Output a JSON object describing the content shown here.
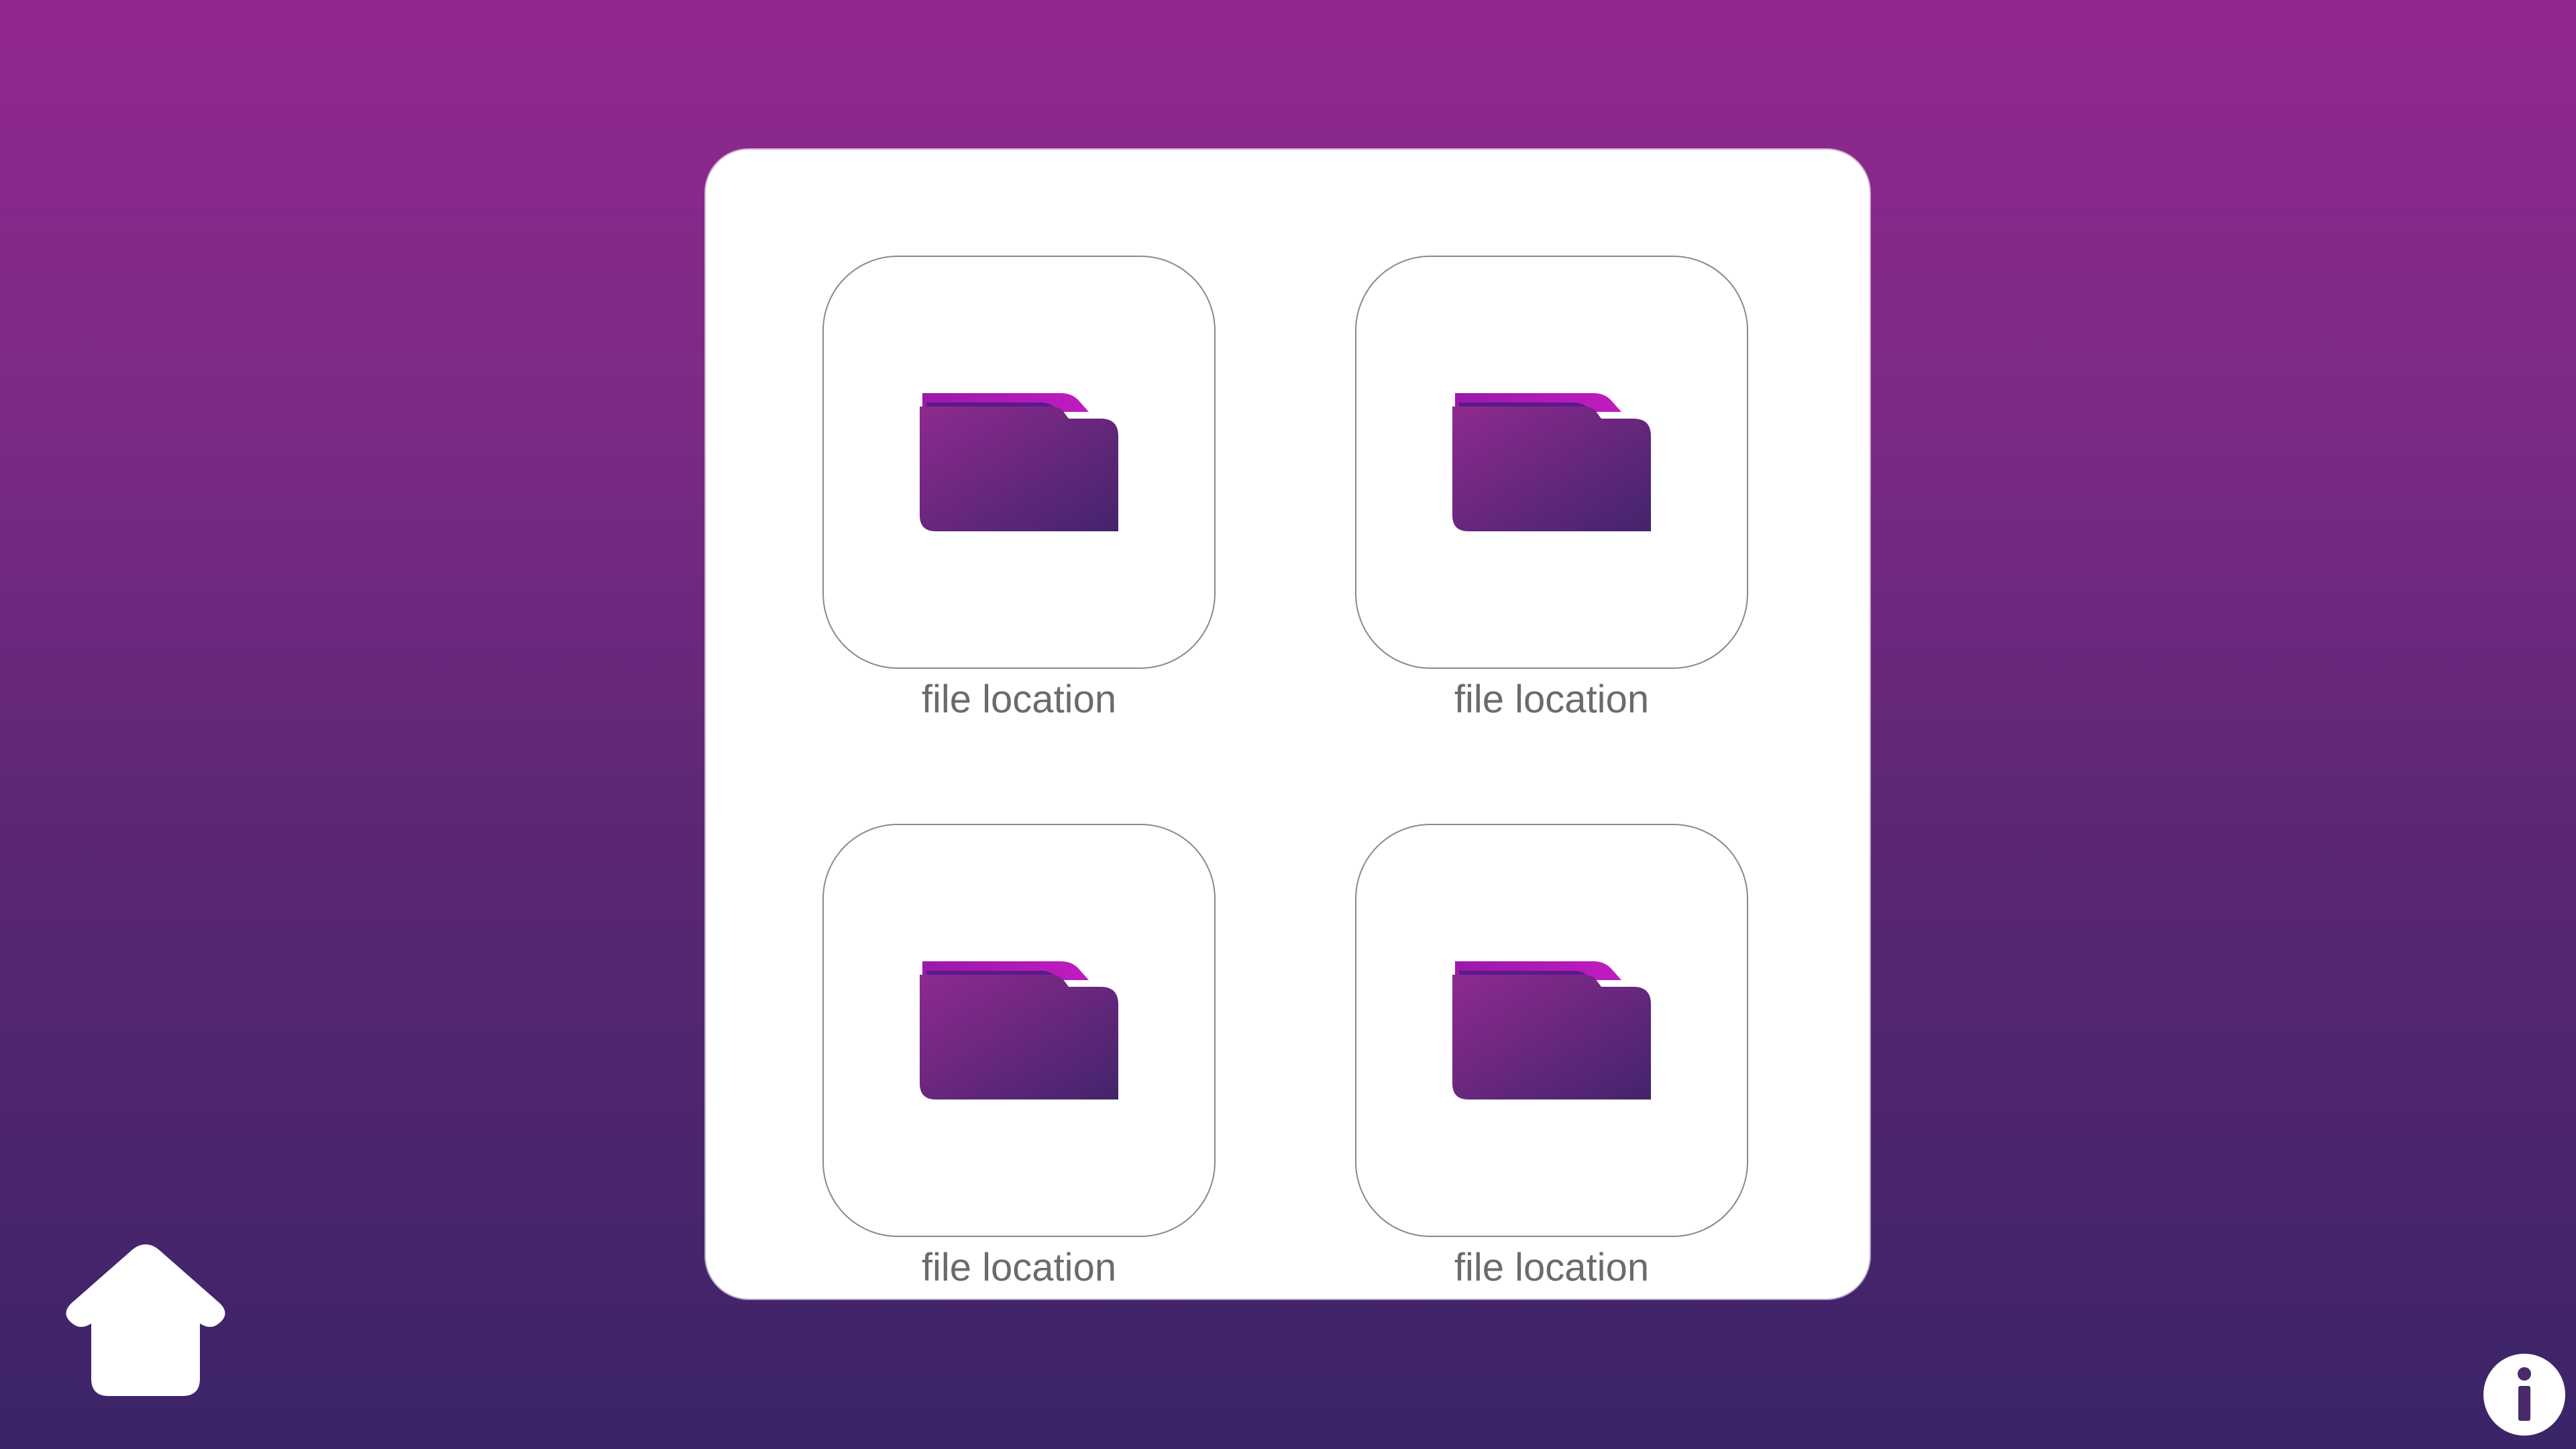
{
  "grid": {
    "items": [
      {
        "label": "file location",
        "icon": "folder-icon"
      },
      {
        "label": "file location",
        "icon": "folder-icon"
      },
      {
        "label": "file location",
        "icon": "folder-icon"
      },
      {
        "label": "file location",
        "icon": "folder-icon"
      }
    ]
  },
  "nav": {
    "home_icon": "home-icon",
    "info_icon": "info-icon"
  },
  "colors": {
    "background_top": "#92278f",
    "background_bottom": "#3b2468",
    "panel": "#ffffff",
    "label_text": "#6b6b6b",
    "folder_light": "#8e2a8f",
    "folder_dark": "#43246b",
    "folder_tab": "#b318b8"
  }
}
